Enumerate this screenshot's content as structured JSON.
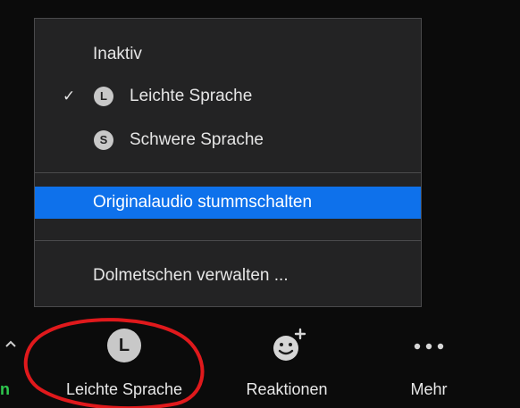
{
  "menu": {
    "items": [
      {
        "label": "Inaktiv",
        "checked": false,
        "badge": ""
      },
      {
        "label": "Leichte Sprache",
        "checked": true,
        "badge": "L"
      },
      {
        "label": "Schwere Sprache",
        "checked": false,
        "badge": "S"
      }
    ],
    "mute_original": "Originalaudio stummschalten",
    "manage": "Dolmetschen verwalten ..."
  },
  "toolbar": {
    "edge_partial_label": "n",
    "interpretation": {
      "label": "Leichte Sprache",
      "badge": "L"
    },
    "reactions": {
      "label": "Reaktionen"
    },
    "more": {
      "label": "Mehr"
    }
  },
  "colors": {
    "highlight": "#0e71eb",
    "menu_background": "#232324",
    "annotation": "#e0191c",
    "partial_label": "#2ec84e"
  }
}
